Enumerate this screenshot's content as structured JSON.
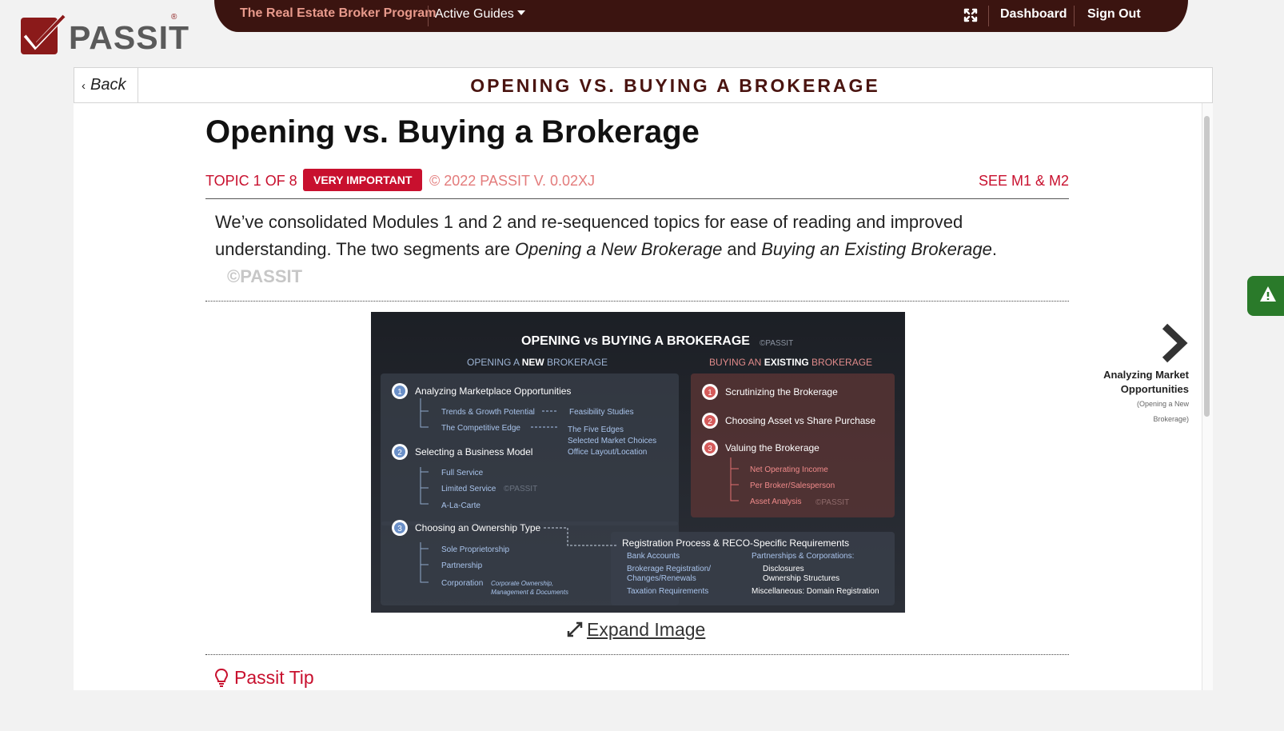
{
  "topbar": {
    "program": "The Real Estate Broker Program",
    "active_guides": "Active Guides",
    "dashboard": "Dashboard",
    "sign_out": "Sign Out"
  },
  "logo": {
    "text": "PASSIT",
    "reg": "®"
  },
  "header": {
    "back": "Back",
    "title": "OPENING VS. BUYING A BROKERAGE"
  },
  "article": {
    "title": "Opening vs. Buying a Brokerage",
    "topic": "TOPIC 1 OF 8",
    "badge": "VERY IMPORTANT",
    "copyright": "© 2022 PASSIT V. 0.02XJ",
    "see": "SEE M1 & M2",
    "intro_1": "We’ve consolidated Modules 1 and 2 and re-sequenced topics for ease of reading and improved understanding. The two segments are ",
    "intro_em1": "Opening a New Brokerage",
    "intro_and": " and ",
    "intro_em2": "Buying an Existing Brokerage",
    "intro_end": ".",
    "watermark": "©PASSIT",
    "expand": "Expand Image",
    "tip": "Passit Tip"
  },
  "diagram": {
    "title": "OPENING vs BUYING A BROKERAGE",
    "wm": "©PASSIT",
    "left_head_a": "OPENING A ",
    "left_head_b": "NEW",
    "left_head_c": " BROKERAGE",
    "right_head_a": "BUYING AN ",
    "right_head_b": "EXISTING",
    "right_head_c": " BROKERAGE",
    "l1": "Analyzing Marketplace Opportunities",
    "l1a": "Trends & Growth Potential",
    "l1a2": "Feasibility Studies",
    "l1b": "The Competitive Edge",
    "l1b2": "The Five Edges",
    "l1b3": "Selected Market Choices",
    "l1b4": "Office Layout/Location",
    "l2": "Selecting a Business Model",
    "l2a": "Full Service",
    "l2b": "Limited Service",
    "l2c": "A-La-Carte",
    "l3": "Choosing an Ownership Type",
    "l3a": "Sole Proprietorship",
    "l3b": "Partnership",
    "l3c": "Corporation",
    "l3c2": "Corporate Ownership,",
    "l3c3": "Management & Documents",
    "r1": "Scrutinizing the Brokerage",
    "r2": "Choosing Asset vs Share Purchase",
    "r3": "Valuing the Brokerage",
    "r3a": "Net Operating Income",
    "r3b": "Per Broker/Salesperson",
    "r3c": "Asset Analysis",
    "reg": "Registration Process & RECO-Specific Requirements",
    "reg_a": "Bank Accounts",
    "reg_b": "Brokerage Registration/",
    "reg_b2": "Changes/Renewals",
    "reg_c": "Taxation Requirements",
    "reg_d": "Partnerships & Corporations:",
    "reg_e": "Disclosures",
    "reg_f": "Ownership Structures",
    "reg_g": "Miscellaneous: Domain Registration",
    "n1": "1",
    "n2": "2",
    "n3": "3"
  },
  "next": {
    "title": "Analyzing Market Opportunities",
    "sub": "(Opening a New Brokerage)"
  }
}
